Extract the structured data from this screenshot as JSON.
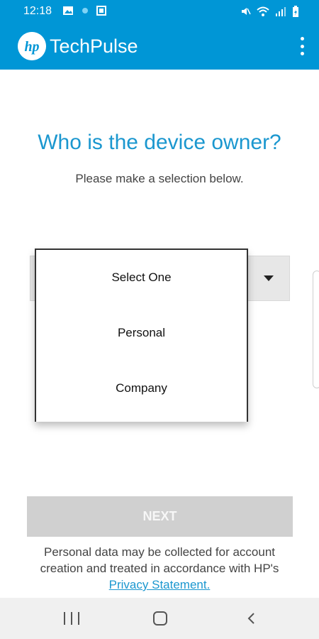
{
  "status_bar": {
    "time": "12:18",
    "left_icons": [
      "image-icon",
      "notification-dot-icon",
      "screenshot-icon"
    ],
    "right_icons": [
      "mute-icon",
      "wifi-icon",
      "signal-icon",
      "battery-icon"
    ]
  },
  "app_bar": {
    "logo_text": "hp",
    "title": "TechPulse",
    "menu_icon": "more-vert-icon"
  },
  "main": {
    "title": "Who is the device owner?",
    "subtitle": "Please make a selection below."
  },
  "owner_select": {
    "options": [
      "Select One",
      "Personal",
      "Company"
    ],
    "arrow_icon": "dropdown-arrow-icon"
  },
  "next_button": {
    "label": "NEXT"
  },
  "notice": {
    "text_line1": "Personal data may be collected for account",
    "text_line2": "creation and treated in accordance with HP's",
    "link_text": "Privacy Statement."
  },
  "nav_bar": {
    "icons": [
      "recents-icon",
      "home-icon",
      "back-icon"
    ]
  },
  "colors": {
    "brand": "#0096d6",
    "title_blue": "#1b97cf",
    "disabled_button": "#d0d0d0"
  }
}
